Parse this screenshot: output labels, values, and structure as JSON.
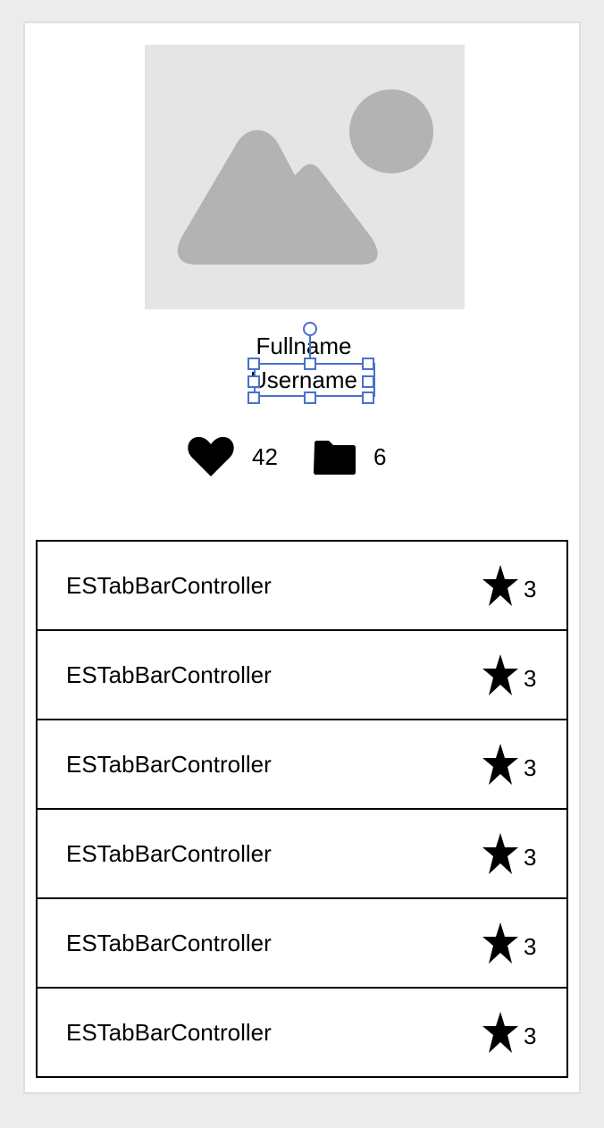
{
  "profile": {
    "image_icon": "image-placeholder-icon",
    "fullname": "Fullname",
    "username": "Username"
  },
  "stats": {
    "likes_icon": "heart-icon",
    "likes": "42",
    "folders_icon": "folder-icon",
    "folders": "6"
  },
  "repos": [
    {
      "name": "ESTabBarController",
      "stars": "3",
      "icon": "star-icon"
    },
    {
      "name": "ESTabBarController",
      "stars": "3",
      "icon": "star-icon"
    },
    {
      "name": "ESTabBarController",
      "stars": "3",
      "icon": "star-icon"
    },
    {
      "name": "ESTabBarController",
      "stars": "3",
      "icon": "star-icon"
    },
    {
      "name": "ESTabBarController",
      "stars": "3",
      "icon": "star-icon"
    },
    {
      "name": "ESTabBarController",
      "stars": "3",
      "icon": "star-icon"
    }
  ],
  "colors": {
    "canvas": "#ececec",
    "artboard": "#ffffff",
    "placeholder_bg": "#e5e5e5",
    "placeholder_shape": "#b3b3b3",
    "selection": "#4a6fd0",
    "text": "#000000"
  }
}
